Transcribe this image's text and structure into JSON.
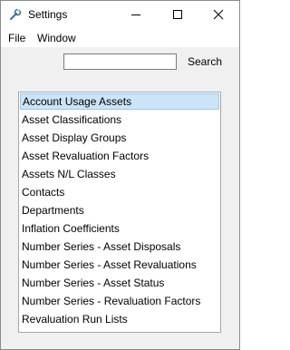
{
  "window": {
    "title": "Settings"
  },
  "menu": {
    "items": [
      "File",
      "Window"
    ]
  },
  "search": {
    "value": "",
    "placeholder": "",
    "button_label": "Search"
  },
  "list": {
    "selected_index": 0,
    "items": [
      "Account Usage Assets",
      "Asset Classifications",
      "Asset Display Groups",
      "Asset Revaluation Factors",
      "Assets N/L Classes",
      "Contacts",
      "Departments",
      "Inflation Coefficients",
      "Number Series - Asset Disposals",
      "Number Series - Asset Revaluations",
      "Number Series - Asset Status",
      "Number Series - Revaluation Factors",
      "Revaluation Run Lists"
    ]
  },
  "colors": {
    "selection_background": "#cce4f7",
    "selection_border": "#99c9ef",
    "window_background": "#f0f0f0"
  },
  "icons": {
    "app": "wrench-gear-icon",
    "minimize": "minimize-icon",
    "maximize": "maximize-icon",
    "close": "close-icon"
  }
}
